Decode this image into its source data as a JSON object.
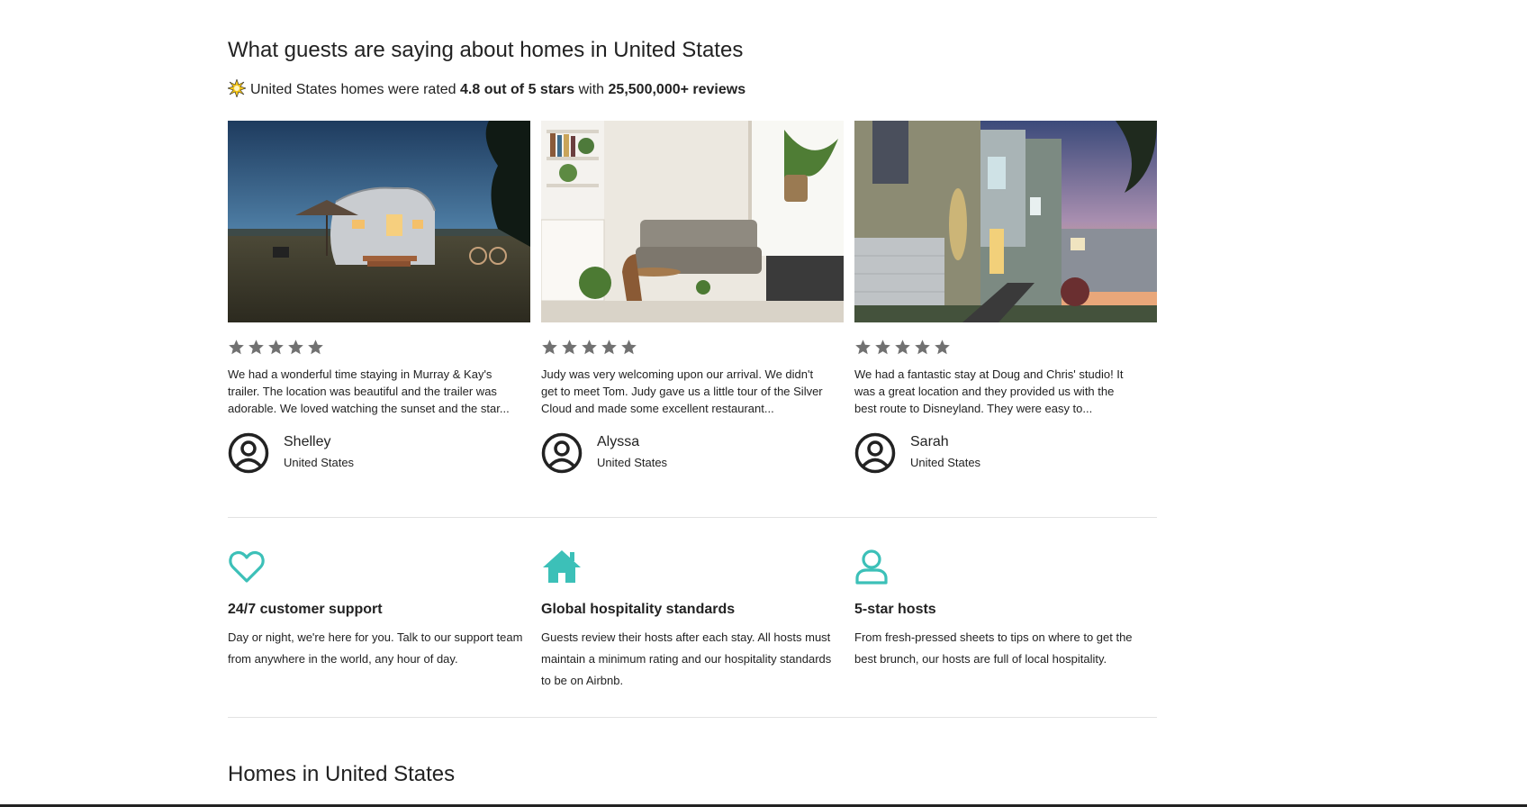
{
  "section": {
    "heading": "What guests are saying about homes in United States",
    "summary": {
      "prefix": "United States homes were rated",
      "rating": "4.8 out of 5 stars",
      "middle": "with",
      "reviews": "25,500,000+ reviews"
    }
  },
  "reviews": [
    {
      "stars": 5,
      "text": "We had a wonderful time staying in Murray & Kay's trailer. The location was beautiful and the trailer was adorable. We loved watching the sunset and the star...",
      "name": "Shelley",
      "location": "United States"
    },
    {
      "stars": 5,
      "text": "Judy was very welcoming upon our arrival. We didn't get to meet Tom. Judy gave us a little tour of the Silver Cloud and made some excellent restaurant...",
      "name": "Alyssa",
      "location": "United States"
    },
    {
      "stars": 5,
      "text": "We had a fantastic stay at Doug and Chris' studio! It was a great location and they provided us with the best route to Disneyland. They were easy to...",
      "name": "Sarah",
      "location": "United States"
    }
  ],
  "features": [
    {
      "icon": "heart-icon",
      "title": "24/7 customer support",
      "description": "Day or night, we're here for you. Talk to our support team from anywhere in the world, any hour of day."
    },
    {
      "icon": "house-icon",
      "title": "Global hospitality standards",
      "description": "Guests review their hosts after each stay. All hosts must maintain a minimum rating and our hospitality standards to be on Airbnb."
    },
    {
      "icon": "person-icon",
      "title": "5-star hosts",
      "description": "From fresh-pressed sheets to tips on where to get the best brunch, our hosts are full of local hospitality."
    }
  ],
  "homes": {
    "heading": "Homes in United States"
  },
  "colors": {
    "accent_teal": "#3cc0b8",
    "star_gray": "#717171",
    "text": "#222222",
    "divider": "#e2e2e2"
  }
}
